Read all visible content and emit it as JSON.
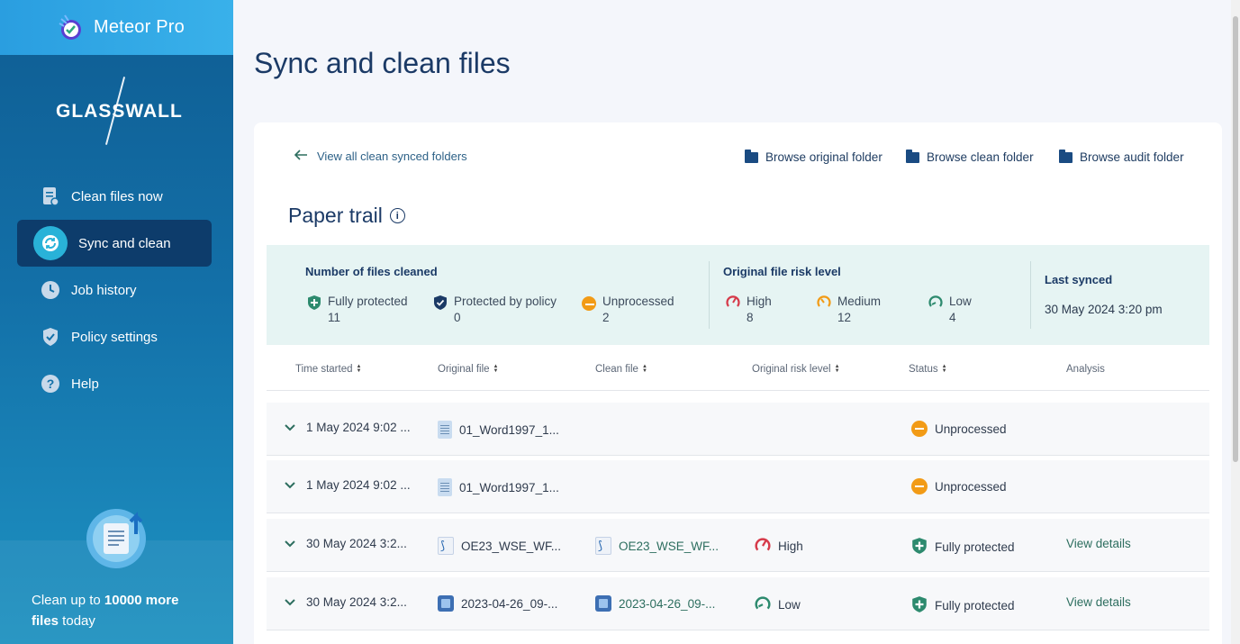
{
  "app": {
    "title": "Meteor Pro",
    "logo_text": "GLASSWALL"
  },
  "sidebar": {
    "items": [
      {
        "label": "Clean files now",
        "icon": "clean-files-icon"
      },
      {
        "label": "Sync and clean",
        "icon": "sync-icon",
        "active": true
      },
      {
        "label": "Job history",
        "icon": "clock-icon"
      },
      {
        "label": "Policy settings",
        "icon": "shield-check-icon"
      },
      {
        "label": "Help",
        "icon": "help-icon"
      }
    ],
    "promo": {
      "prefix": "Clean up to ",
      "count": "10000 more",
      "files": "files",
      "suffix": " today"
    }
  },
  "main": {
    "title": "Sync and clean files",
    "back_link": "View all clean synced folders",
    "browse": [
      {
        "label": "Browse original folder"
      },
      {
        "label": "Browse clean folder"
      },
      {
        "label": "Browse audit folder"
      }
    ],
    "section_title": "Paper trail",
    "summary": {
      "files_cleaned_heading": "Number of files cleaned",
      "fully_protected": {
        "label": "Fully protected",
        "value": "11"
      },
      "protected_by_policy": {
        "label": "Protected by policy",
        "value": "0"
      },
      "unprocessed": {
        "label": "Unprocessed",
        "value": "2"
      },
      "risk_heading": "Original file risk level",
      "high": {
        "label": "High",
        "value": "8"
      },
      "medium": {
        "label": "Medium",
        "value": "12"
      },
      "low": {
        "label": "Low",
        "value": "4"
      },
      "last_synced_heading": "Last synced",
      "last_synced_value": "30 May 2024 3:20 pm"
    },
    "table": {
      "headers": {
        "time_started": "Time started",
        "original_file": "Original file",
        "clean_file": "Clean file",
        "risk_level": "Original risk level",
        "status": "Status",
        "analysis": "Analysis"
      },
      "rows": [
        {
          "time": "1 May 2024 9:02 ...",
          "original": "01_Word1997_1...",
          "clean": "",
          "risk": "",
          "status": "Unprocessed",
          "analysis": ""
        },
        {
          "time": "1 May 2024 9:02 ...",
          "original": "01_Word1997_1...",
          "clean": "",
          "risk": "",
          "status": "Unprocessed",
          "analysis": ""
        },
        {
          "time": "30 May 2024 3:2...",
          "original": "OE23_WSE_WF...",
          "clean": "OE23_WSE_WF...",
          "risk": "High",
          "status": "Fully protected",
          "analysis": "View details"
        },
        {
          "time": "30 May 2024 3:2...",
          "original": "2023-04-26_09-...",
          "clean": "2023-04-26_09-...",
          "risk": "Low",
          "status": "Fully protected",
          "analysis": "View details"
        }
      ]
    }
  },
  "colors": {
    "accent": "#2d6e5f",
    "sidebar": "#1370a8",
    "summary_bg": "#e6f4f3",
    "unprocessed": "#f29b16",
    "high": "#d63a4a",
    "medium": "#f29b16",
    "low": "#2d8a6e"
  }
}
